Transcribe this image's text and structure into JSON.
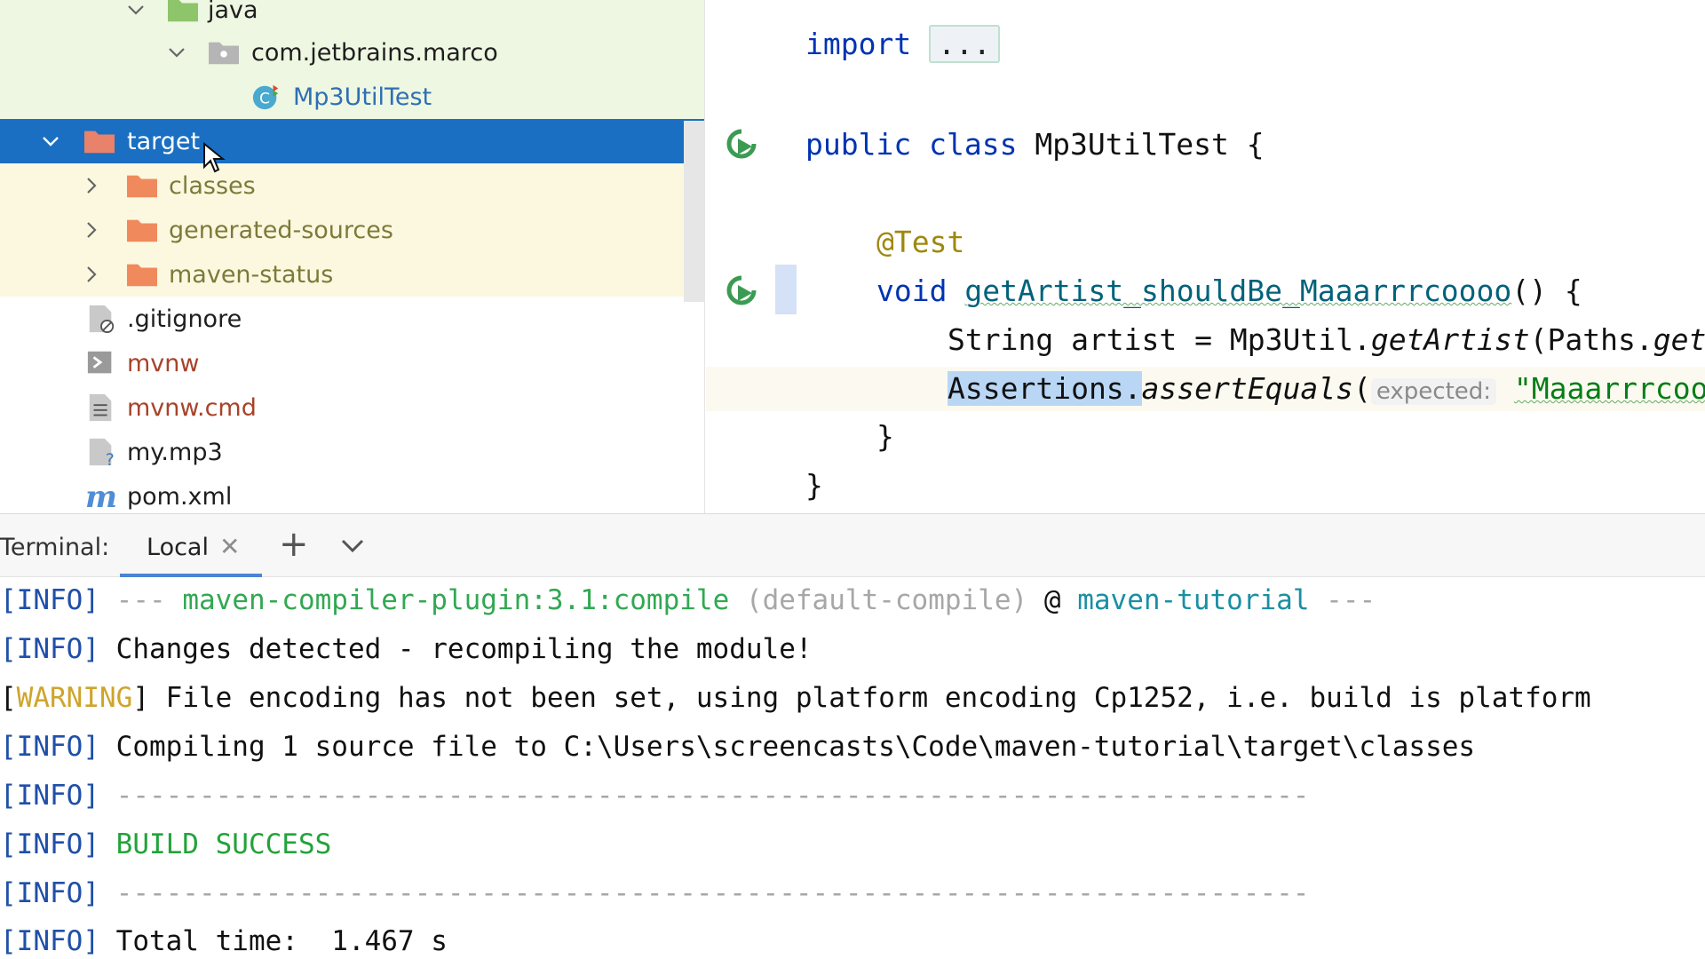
{
  "project_tree": {
    "items": [
      {
        "label": "java",
        "icon": "source-folder-icon"
      },
      {
        "label": "com.jetbrains.marco",
        "icon": "package-icon"
      },
      {
        "label": "Mp3UtilTest",
        "icon": "test-class-icon"
      },
      {
        "label": "target",
        "icon": "excluded-folder-icon",
        "selected": true
      },
      {
        "label": "classes",
        "icon": "excluded-folder-icon"
      },
      {
        "label": "generated-sources",
        "icon": "excluded-folder-icon"
      },
      {
        "label": "maven-status",
        "icon": "excluded-folder-icon"
      },
      {
        "label": ".gitignore",
        "icon": "ignored-file-icon"
      },
      {
        "label": "mvnw",
        "icon": "shell-script-icon"
      },
      {
        "label": "mvnw.cmd",
        "icon": "text-file-icon"
      },
      {
        "label": "my.mp3",
        "icon": "unknown-file-icon"
      },
      {
        "label": "pom.xml",
        "icon": "maven-icon"
      }
    ]
  },
  "editor": {
    "import_kw": "import",
    "import_folded": "...",
    "class_kw1": "public",
    "class_kw2": "class",
    "class_name": "Mp3UtilTest {",
    "annotation": "@Test",
    "void_kw": "void",
    "method_name": "getArtist_shouldBe_Maaarrrcoooo",
    "method_tail": "() {",
    "line3_a": "String artist = Mp3Util.",
    "line3_b": "getArtist",
    "line3_c": "(Paths.",
    "line3_d": "get",
    "line4_a": "Assertions.",
    "line4_b": "assertEquals",
    "line4_c": "(",
    "line4_hint": "expected:",
    "line4_str": "\"Maaarrrcoo",
    "close1": "}",
    "close2": "}"
  },
  "terminal": {
    "title": "Terminal:",
    "tab_label": "Local",
    "tab_close": "✕",
    "add_label": "+",
    "lines": {
      "l1_tag": "[INFO]",
      "l1_dashes": "---",
      "l1_plugin": "maven-compiler-plugin:3.1:compile",
      "l1_exec": "(default-compile)",
      "l1_at": "@",
      "l1_proj": "maven-tutorial",
      "l1_end": "---",
      "l2_tag": "[INFO]",
      "l2_text": "Changes detected - recompiling the module!",
      "l3_tag": "WARNING",
      "l3_text": "File encoding has not been set, using platform encoding Cp1252, i.e. build is platform",
      "l4_tag": "[INFO]",
      "l4_text": "Compiling 1 source file to C:\\Users\\screencasts\\Code\\maven-tutorial\\target\\classes",
      "l5_tag": "[INFO]",
      "l5_rule": "------------------------------------------------------------------------",
      "l6_tag": "[INFO]",
      "l6_text": "BUILD SUCCESS",
      "l7_tag": "[INFO]",
      "l7_rule": "------------------------------------------------------------------------",
      "l8_tag": "[INFO]",
      "l8_text": "Total time:  1.467 s"
    }
  },
  "colors": {
    "selection": "#1a6fc2",
    "source_bg": "#eef7e2",
    "excluded_bg": "#fcf8e0",
    "excluded_folder": "#e8826a",
    "keyword": "#0033b3",
    "info": "#1f4fa8",
    "warning": "#cfa42b",
    "success": "#22a33a"
  }
}
